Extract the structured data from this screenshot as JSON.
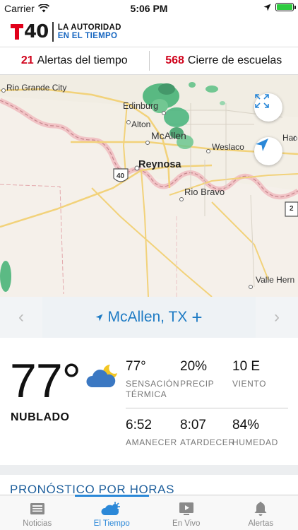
{
  "status_bar": {
    "carrier": "Carrier",
    "time": "5:06 PM"
  },
  "header": {
    "logo_number": "40",
    "logo_line1": "LA AUTORIDAD",
    "logo_line2": "EN EL TIEMPO"
  },
  "alerts": {
    "weather_count": "21",
    "weather_label": "Alertas del tiempo",
    "schools_count": "568",
    "schools_label": "Cierre de escuelas"
  },
  "map": {
    "cities": [
      "Rio Grande City",
      "Edinburg",
      "Alton",
      "McAllen",
      "Weslaco",
      "Reynosa",
      "Rio Bravo",
      "Valle Hern",
      "Har"
    ],
    "highways": [
      "40",
      "2"
    ]
  },
  "location": {
    "name": "McAllen, TX",
    "add_symbol": "+",
    "prev": "‹",
    "next": "›"
  },
  "current": {
    "temperature": "77°",
    "condition": "NUBLADO",
    "icon": "partly-cloudy-night-icon",
    "stats": [
      {
        "value": "77°",
        "label1": "SENSACIÓN",
        "label2": "TÉRMICA"
      },
      {
        "value": "20%",
        "label1": "PRECIP",
        "label2": ""
      },
      {
        "value": "10 E",
        "label1": "VIENTO",
        "label2": ""
      },
      {
        "value": "6:52",
        "label1": "AMANECER",
        "label2": ""
      },
      {
        "value": "8:07",
        "label1": "ATARDECER",
        "label2": ""
      },
      {
        "value": "84%",
        "label1": "HUMEDAD",
        "label2": ""
      }
    ]
  },
  "hourly_title": "PRONÓSTICO POR HORAS",
  "tabs": [
    {
      "label": "Noticias",
      "icon": "news-icon",
      "active": false
    },
    {
      "label": "El Tiempo",
      "icon": "weather-icon",
      "active": true
    },
    {
      "label": "En Vivo",
      "icon": "play-icon",
      "active": false
    },
    {
      "label": "Alertas",
      "icon": "bell-icon",
      "active": false
    }
  ],
  "colors": {
    "accent": "#2b88d8",
    "alert_red": "#d0021b",
    "brand_red": "#e1001a"
  }
}
